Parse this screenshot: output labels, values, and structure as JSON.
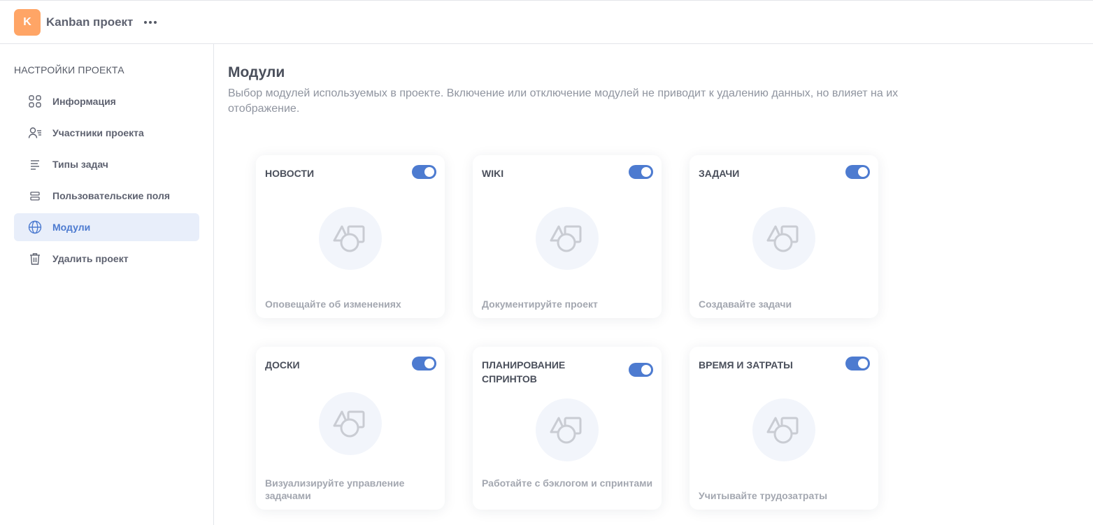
{
  "header": {
    "avatar_letter": "K",
    "avatar_color": "#ffa566",
    "project_name": "Kanban проект",
    "more_icon": "more-horizontal-icon"
  },
  "sidebar": {
    "heading": "НАСТРОЙКИ ПРОЕКТА",
    "items": [
      {
        "label": "Информация",
        "icon": "grid-icon",
        "active": false
      },
      {
        "label": "Участники проекта",
        "icon": "users-list-icon",
        "active": false
      },
      {
        "label": "Типы задач",
        "icon": "lines-icon",
        "active": false
      },
      {
        "label": "Пользовательские поля",
        "icon": "fields-icon",
        "active": false
      },
      {
        "label": "Модули",
        "icon": "globe-icon",
        "active": true
      },
      {
        "label": "Удалить проект",
        "icon": "trash-icon",
        "active": false
      }
    ]
  },
  "main": {
    "title": "Модули",
    "description": "Выбор модулей используемых в проекте. Включение или отключение модулей не приводит к удалению данных, но влияет на их отображение.",
    "modules": [
      {
        "title": "НОВОСТИ",
        "description": "Оповещайте об изменениях",
        "enabled": true
      },
      {
        "title": "WIKI",
        "description": "Документируйте проект",
        "enabled": true
      },
      {
        "title": "ЗАДАЧИ",
        "description": "Создавайте задачи",
        "enabled": true
      },
      {
        "title": "ДОСКИ",
        "description": "Визуализируйте управление задачами",
        "enabled": true
      },
      {
        "title": "ПЛАНИРОВАНИЕ СПРИНТОВ",
        "description": "Работайте с бэклогом и спринтами",
        "enabled": true
      },
      {
        "title": "ВРЕМЯ И ЗАТРАТЫ",
        "description": "Учитывайте трудозатраты",
        "enabled": true
      }
    ]
  },
  "colors": {
    "accent": "#4d7bd0",
    "active_nav_bg": "#e8eefa"
  }
}
